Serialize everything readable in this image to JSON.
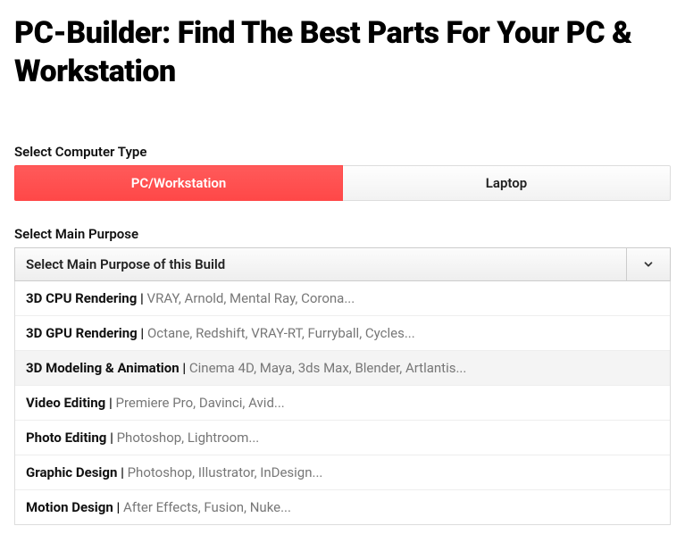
{
  "heading": "PC-Builder: Find The Best Parts For Your PC & Workstation",
  "computerType": {
    "label": "Select Computer Type",
    "tabs": [
      {
        "label": "PC/Workstation",
        "active": true
      },
      {
        "label": "Laptop",
        "active": false
      }
    ]
  },
  "mainPurpose": {
    "label": "Select Main Purpose",
    "placeholder": "Select Main Purpose of this Build",
    "options": [
      {
        "title": "3D CPU Rendering | ",
        "sub": "VRAY, Arnold, Mental Ray, Corona...",
        "hovered": false
      },
      {
        "title": "3D GPU Rendering | ",
        "sub": "Octane, Redshift, VRAY-RT, Furryball, Cycles...",
        "hovered": false
      },
      {
        "title": "3D Modeling & Animation | ",
        "sub": "Cinema 4D, Maya, 3ds Max, Blender, Artlantis...",
        "hovered": true
      },
      {
        "title": "Video Editing | ",
        "sub": "Premiere Pro, Davinci, Avid...",
        "hovered": false
      },
      {
        "title": "Photo Editing | ",
        "sub": "Photoshop, Lightroom...",
        "hovered": false
      },
      {
        "title": "Graphic Design | ",
        "sub": "Photoshop, Illustrator, InDesign...",
        "hovered": false
      },
      {
        "title": "Motion Design | ",
        "sub": "After Effects, Fusion, Nuke...",
        "hovered": false
      }
    ]
  }
}
